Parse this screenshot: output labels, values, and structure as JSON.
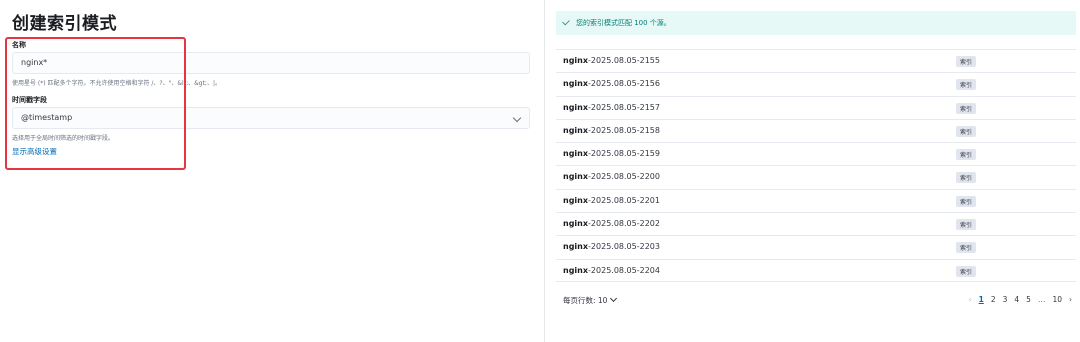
{
  "page": {
    "title": "创建索引模式"
  },
  "form": {
    "name_label": "名称",
    "name_value": "nginx*",
    "name_help": "使用星号 (*) 匹配多个字符。不允许使用空格和字符 /、?、\"、&lt;、&gt;、|。",
    "time_label": "时间戳字段",
    "time_value": "@timestamp",
    "time_help": "选择用于全局时间筛选的时间戳字段。",
    "advanced_link": "显示高级设置"
  },
  "callout": {
    "message": "您的索引模式匹配 100 个源。"
  },
  "table": {
    "rows": [
      {
        "prefix": "nginx",
        "suffix": "-2025.08.05-2155",
        "badge": "索引"
      },
      {
        "prefix": "nginx",
        "suffix": "-2025.08.05-2156",
        "badge": "索引"
      },
      {
        "prefix": "nginx",
        "suffix": "-2025.08.05-2157",
        "badge": "索引"
      },
      {
        "prefix": "nginx",
        "suffix": "-2025.08.05-2158",
        "badge": "索引"
      },
      {
        "prefix": "nginx",
        "suffix": "-2025.08.05-2159",
        "badge": "索引"
      },
      {
        "prefix": "nginx",
        "suffix": "-2025.08.05-2200",
        "badge": "索引"
      },
      {
        "prefix": "nginx",
        "suffix": "-2025.08.05-2201",
        "badge": "索引"
      },
      {
        "prefix": "nginx",
        "suffix": "-2025.08.05-2202",
        "badge": "索引"
      },
      {
        "prefix": "nginx",
        "suffix": "-2025.08.05-2203",
        "badge": "索引"
      },
      {
        "prefix": "nginx",
        "suffix": "-2025.08.05-2204",
        "badge": "索引"
      }
    ]
  },
  "pagination": {
    "rows_per_page": "每页行数: 10",
    "prev": "‹",
    "pages": [
      "1",
      "2",
      "3",
      "4",
      "5"
    ],
    "ellipsis": "…",
    "last": "10",
    "next": "›",
    "current": "1"
  },
  "colors": {
    "highlight": "#e7343f",
    "link": "#006bb8",
    "success": "#017d73"
  }
}
